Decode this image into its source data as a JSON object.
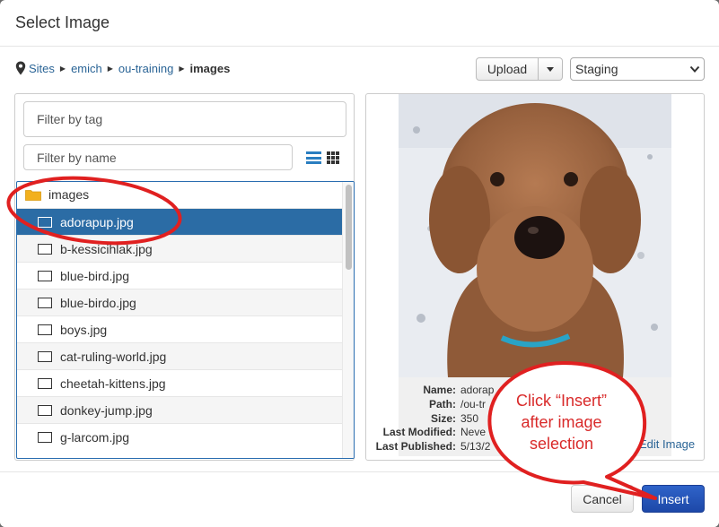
{
  "dialog": {
    "title": "Select Image"
  },
  "breadcrumb": [
    "Sites",
    "emich",
    "ou-training",
    "images"
  ],
  "toolbar": {
    "upload_label": "Upload",
    "environment": "Staging"
  },
  "filters": {
    "tag_placeholder": "Filter by tag",
    "name_placeholder": "Filter by name"
  },
  "tree": {
    "folder": "images",
    "files": [
      "adorapup.jpg",
      "b-kessicihlak.jpg",
      "blue-bird.jpg",
      "blue-birdo.jpg",
      "boys.jpg",
      "cat-ruling-world.jpg",
      "cheetah-kittens.jpg",
      "donkey-jump.jpg",
      "g-larcom.jpg"
    ],
    "selected_index": 0
  },
  "details": {
    "labels": [
      "Name:",
      "Path:",
      "Size:",
      "Last Modified:",
      "Last Published:"
    ],
    "values": [
      "adorap",
      "/ou-tr",
      "350",
      "Neve",
      "5/13/2"
    ],
    "edit_label": "Edit Image"
  },
  "footer": {
    "cancel_label": "Cancel",
    "insert_label": "Insert"
  },
  "annotation": {
    "lines": [
      "Click “Insert”",
      "after image",
      "selection"
    ]
  },
  "colors": {
    "accent": "#2b6ca5",
    "primary_button": "#1d48a8",
    "annotation": "#e02020"
  }
}
